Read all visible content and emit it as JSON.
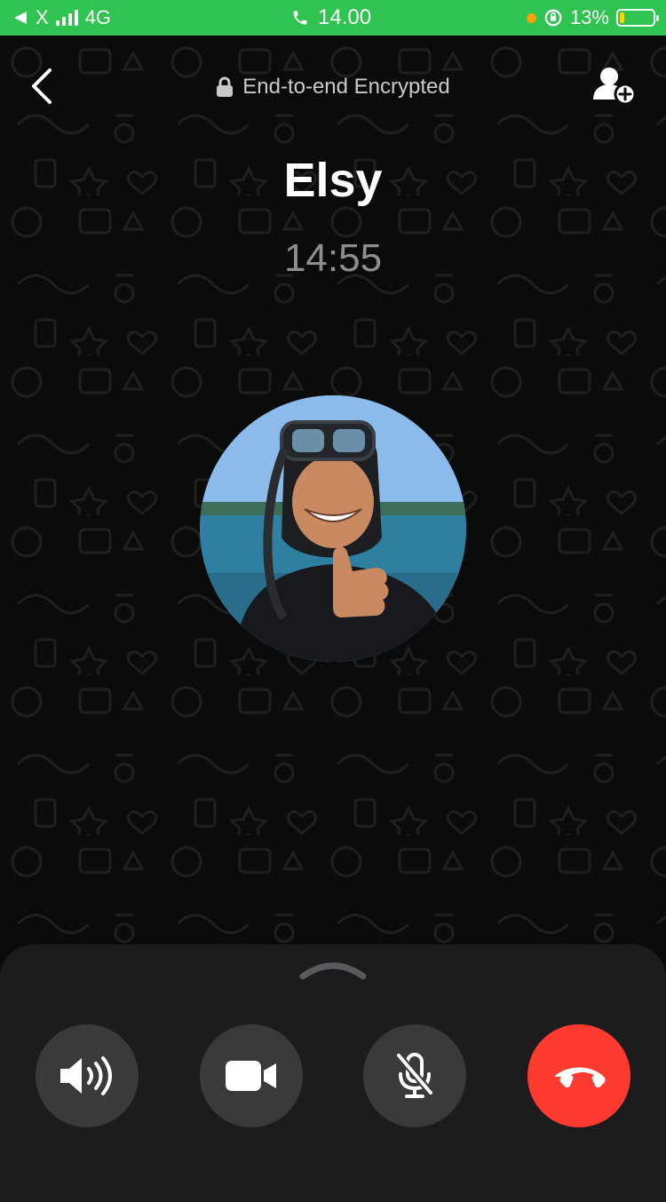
{
  "status_bar": {
    "carrier": "X",
    "network": "4G",
    "time": "14.00",
    "battery_percent": "13%",
    "battery_level": 0.13
  },
  "header": {
    "encryption_label": "End-to-end Encrypted",
    "icons": [
      "back-chevron-icon",
      "lock-icon",
      "add-person-icon"
    ]
  },
  "call": {
    "contact_name": "Elsy",
    "duration": "14:55"
  },
  "controls": [
    {
      "name": "speaker",
      "icon": "speaker-icon"
    },
    {
      "name": "video",
      "icon": "video-camera-icon"
    },
    {
      "name": "mute",
      "icon": "microphone-muted-icon"
    },
    {
      "name": "end-call",
      "icon": "phone-hangup-icon"
    }
  ],
  "colors": {
    "status_bar": "#2fc351",
    "background": "#0b0b0b",
    "sheet": "#1c1c1e",
    "control_button": "#3a3a3c",
    "end_call": "#ff3b30",
    "battery_fill": "#ffd60a"
  }
}
